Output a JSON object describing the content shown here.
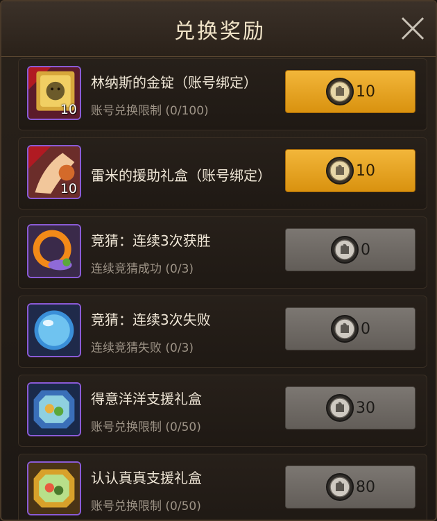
{
  "header": {
    "title": "兑换奖励"
  },
  "items": [
    {
      "name": "林纳斯的金锭（账号绑定）",
      "limit": "账号兑换限制 (0/100)",
      "count": "10",
      "price": "10",
      "enabled": true,
      "icon": "gold-ingot-icon"
    },
    {
      "name": "雷米的援助礼盒（账号绑定）",
      "limit": "",
      "count": "10",
      "price": "10",
      "enabled": true,
      "icon": "gift-glove-icon"
    },
    {
      "name": "竞猜：连续3次获胜",
      "limit": "连续竞猜成功 (0/3)",
      "count": "",
      "price": "0",
      "enabled": false,
      "icon": "orange-ring-icon"
    },
    {
      "name": "竞猜：连续3次失败",
      "limit": "连续竞猜失败 (0/3)",
      "count": "",
      "price": "0",
      "enabled": false,
      "icon": "crystal-orb-icon"
    },
    {
      "name": "得意洋洋支援礼盒",
      "limit": "账号兑换限制 (0/50)",
      "count": "",
      "price": "30",
      "enabled": false,
      "icon": "blue-gift-box-icon"
    },
    {
      "name": "认认真真支援礼盒",
      "limit": "账号兑换限制 (0/50)",
      "count": "",
      "price": "80",
      "enabled": false,
      "icon": "gold-gift-box-icon"
    }
  ],
  "colors": {
    "gold_button": "#e9a522",
    "gray_button": "#706b66",
    "rare_border": "#8a5bd6"
  }
}
